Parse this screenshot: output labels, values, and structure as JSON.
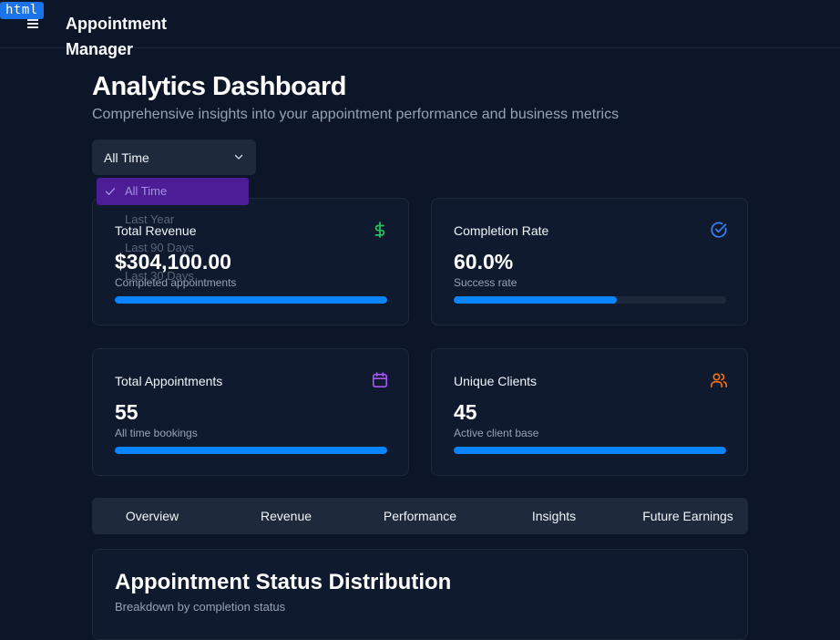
{
  "badge": "html",
  "app": {
    "title": "Appointment Manager"
  },
  "header": {
    "title": "Analytics Dashboard",
    "subtitle": "Comprehensive insights into your appointment performance and business metrics"
  },
  "filter": {
    "selected": "All Time",
    "options": [
      "All Time",
      "Last Year",
      "Last 90 Days",
      "Last 30 Days"
    ]
  },
  "cards": [
    {
      "title": "Total Revenue",
      "value": "$304,100.00",
      "sub": "Completed appointments",
      "icon": "dollar-icon",
      "icon_color": "#22c55e",
      "progress": 1.0
    },
    {
      "title": "Completion Rate",
      "value": "60.0%",
      "sub": "Success rate",
      "icon": "check-circle-icon",
      "icon_color": "#3b82f6",
      "progress": 0.6
    },
    {
      "title": "Total Appointments",
      "value": "55",
      "sub": "All time bookings",
      "icon": "calendar-icon",
      "icon_color": "#a855f7",
      "progress": 1.0
    },
    {
      "title": "Unique Clients",
      "value": "45",
      "sub": "Active client base",
      "icon": "users-icon",
      "icon_color": "#f97316",
      "progress": 1.0
    }
  ],
  "tabs": [
    "Overview",
    "Revenue",
    "Performance",
    "Insights",
    "Future Earnings"
  ],
  "status": {
    "title": "Appointment Status Distribution",
    "subtitle": "Breakdown by completion status"
  },
  "colors": {
    "background": "#0d1628",
    "accent": "#0a84ff",
    "track": "#1e293b",
    "selected": "#4c1d95"
  }
}
